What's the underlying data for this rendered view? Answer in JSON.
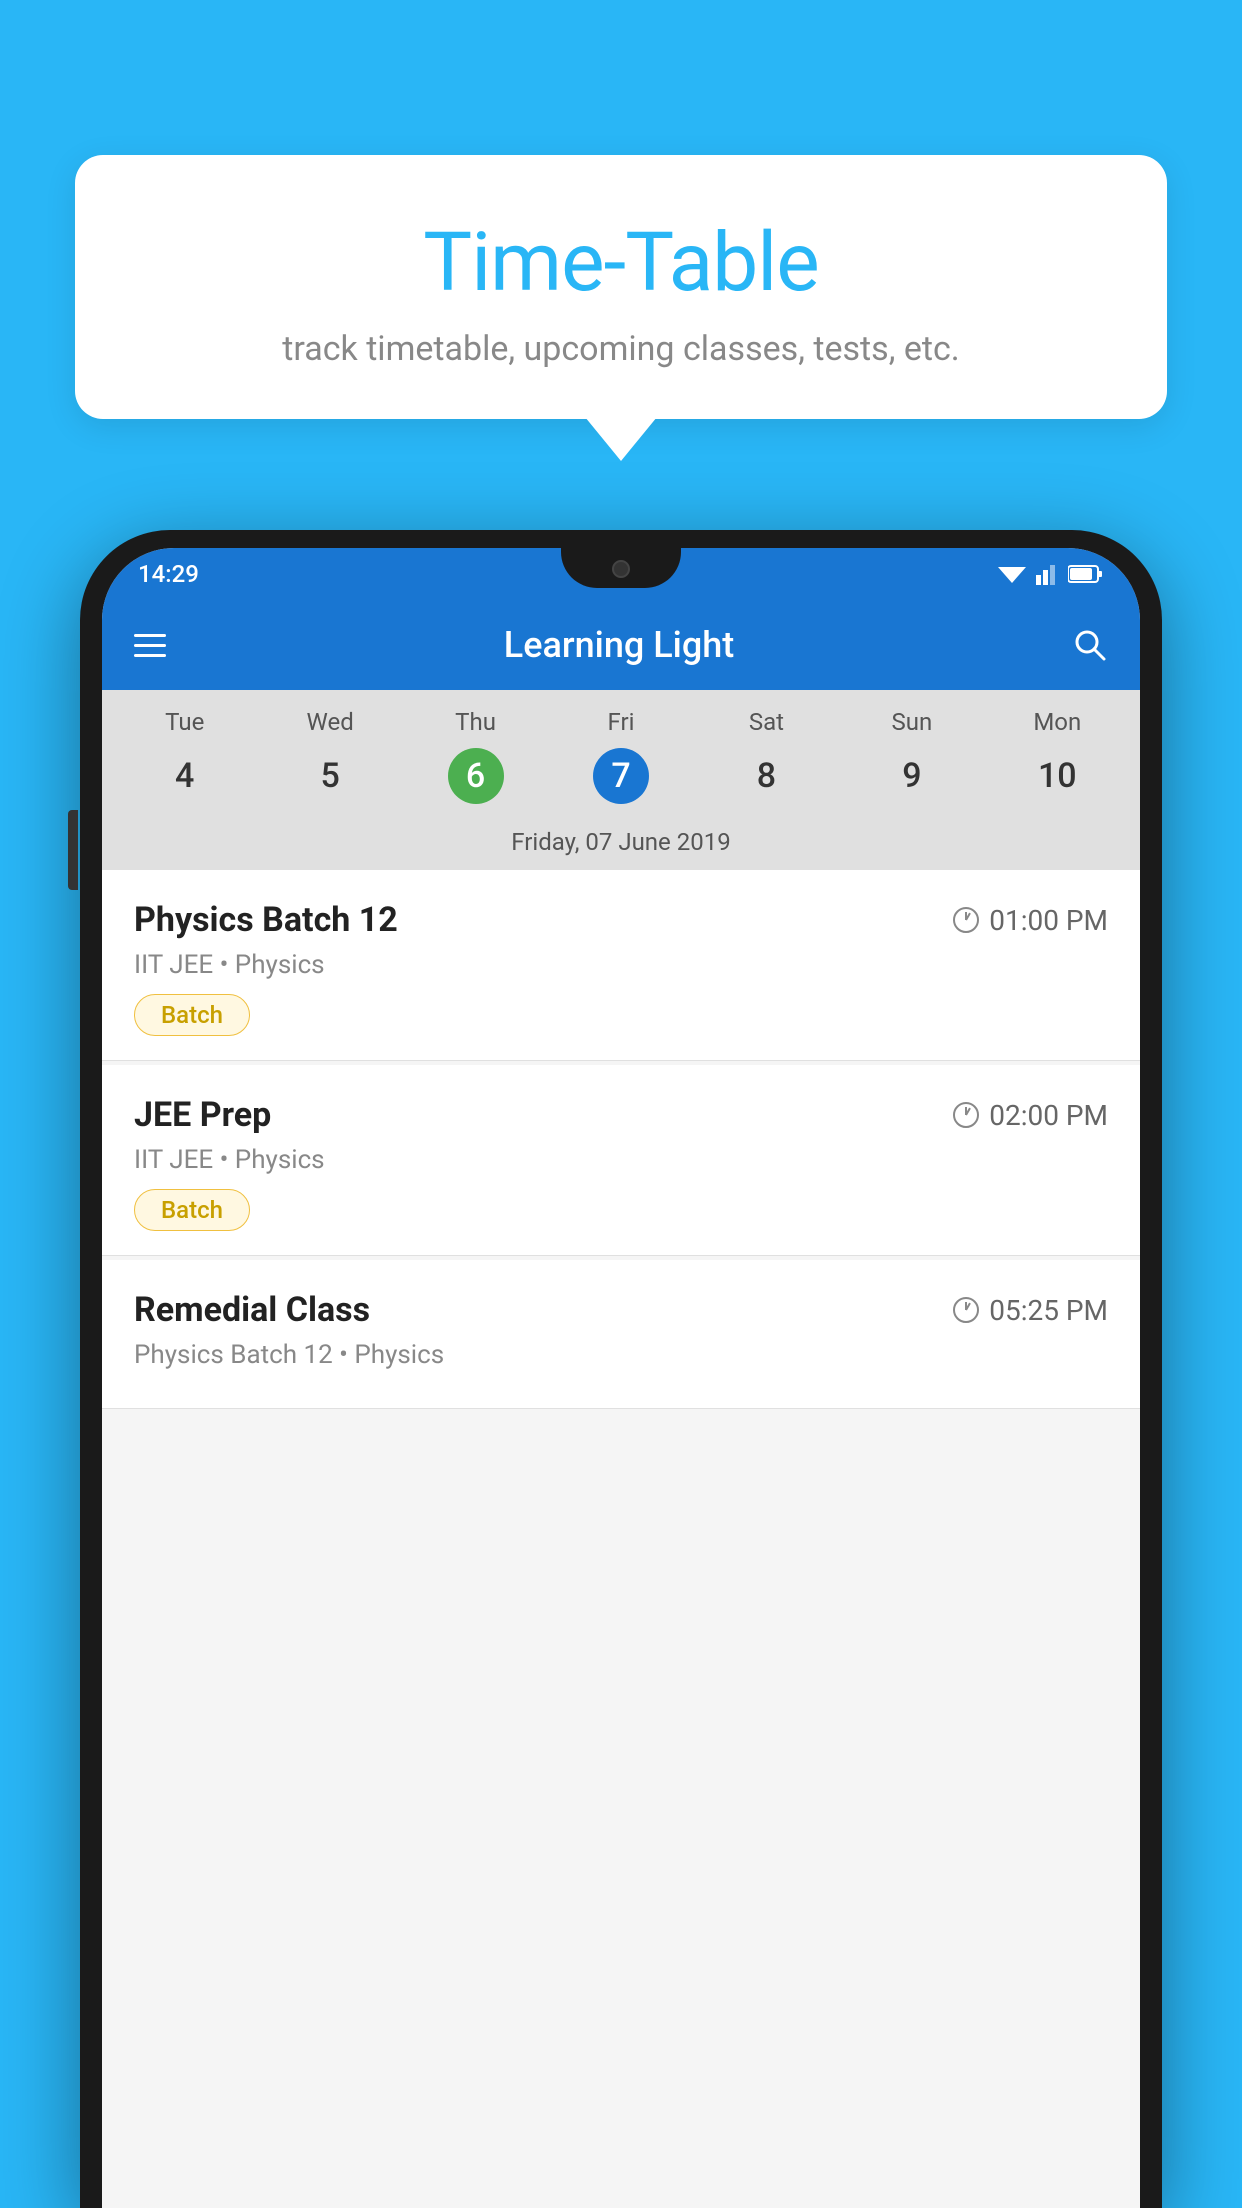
{
  "page": {
    "background_color": "#29b6f6"
  },
  "tooltip": {
    "title": "Time-Table",
    "subtitle": "track timetable, upcoming classes, tests, etc."
  },
  "phone": {
    "status_bar": {
      "time": "14:29",
      "icons": [
        "▼",
        "▲",
        "▌"
      ]
    },
    "app_bar": {
      "title": "Learning Light",
      "menu_icon": "hamburger",
      "search_icon": "search"
    },
    "calendar": {
      "days": [
        "Tue",
        "Wed",
        "Thu",
        "Fri",
        "Sat",
        "Sun",
        "Mon"
      ],
      "dates": [
        "4",
        "5",
        "6",
        "7",
        "8",
        "9",
        "10"
      ],
      "today_index": 2,
      "selected_index": 3,
      "selected_label": "Friday, 07 June 2019"
    },
    "classes": [
      {
        "name": "Physics Batch 12",
        "time": "01:00 PM",
        "meta": "IIT JEE • Physics",
        "badge": "Batch"
      },
      {
        "name": "JEE Prep",
        "time": "02:00 PM",
        "meta": "IIT JEE • Physics",
        "badge": "Batch"
      },
      {
        "name": "Remedial Class",
        "time": "05:25 PM",
        "meta": "Physics Batch 12 • Physics",
        "badge": ""
      }
    ]
  }
}
